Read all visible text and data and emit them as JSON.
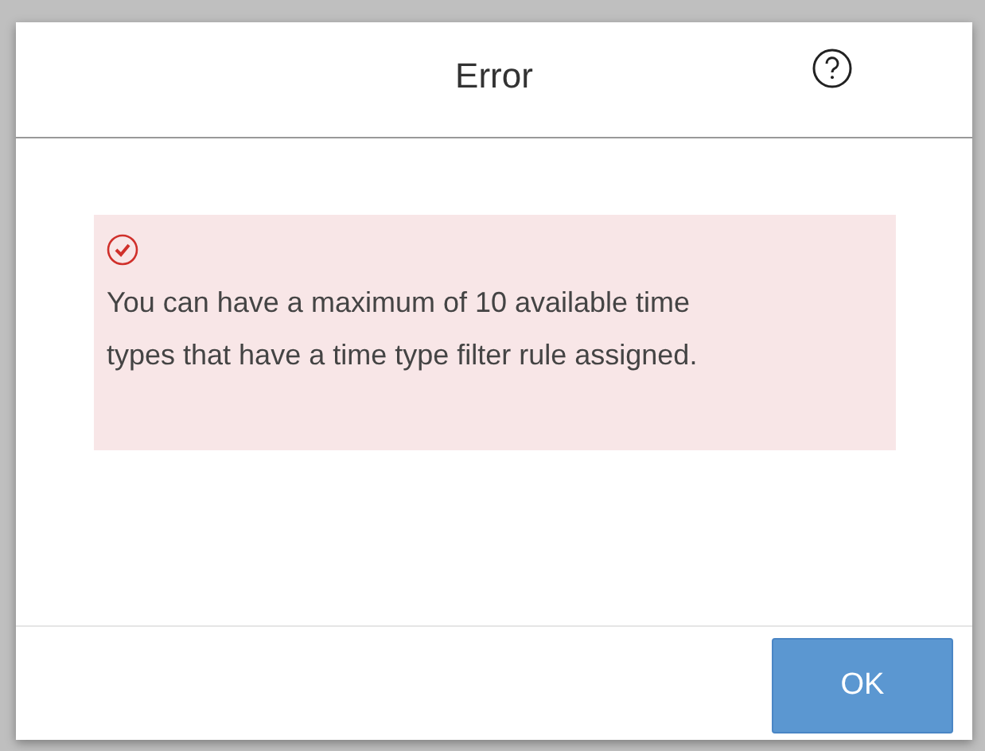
{
  "dialog": {
    "title": "Error",
    "message": {
      "kind": "error",
      "text": "You can have a maximum of 10 available time types that have a time type filter rule assigned."
    },
    "buttons": [
      {
        "label": "OK",
        "kind": "primary"
      }
    ]
  }
}
